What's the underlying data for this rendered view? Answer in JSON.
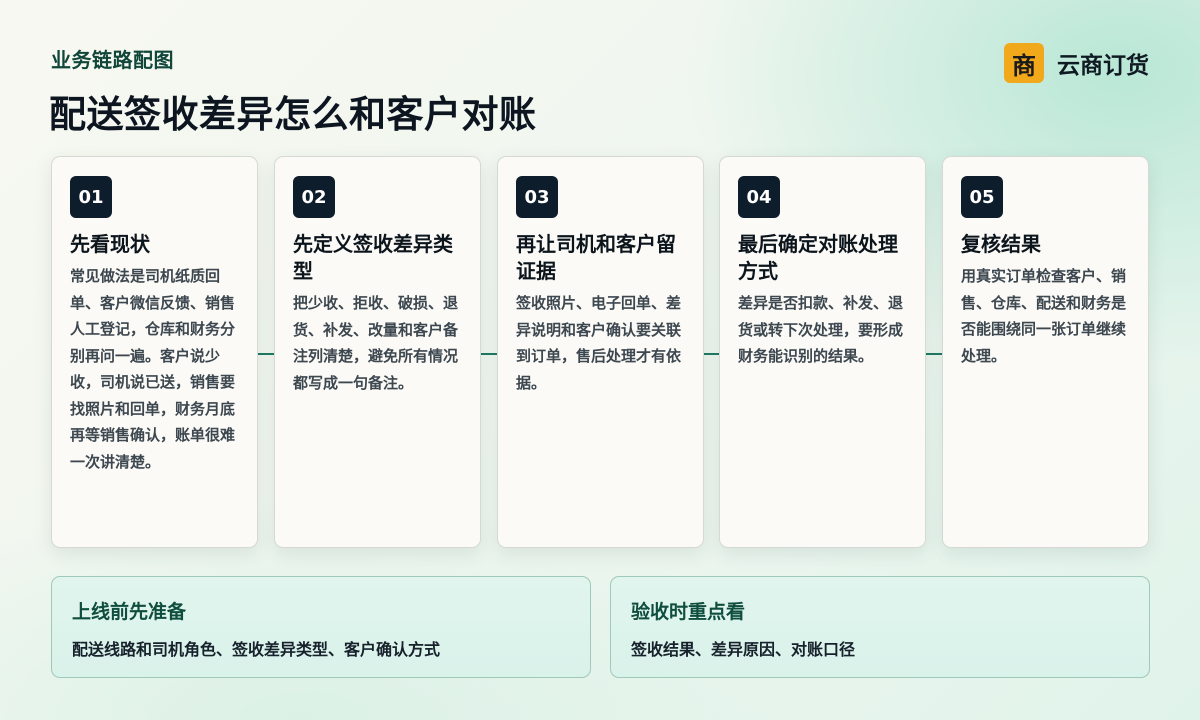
{
  "header": {
    "kicker": "业务链路配图",
    "title": "配送签收差异怎么和客户对账"
  },
  "brand": {
    "badge": "商",
    "name": "云商订货",
    "badge_color": "#f2a81b"
  },
  "steps": [
    {
      "num": "01",
      "title": "先看现状",
      "body": "常见做法是司机纸质回单、客户微信反馈、销售人工登记，仓库和财务分别再问一遍。客户说少收，司机说已送，销售要找照片和回单，财务月底再等销售确认，账单很难一次讲清楚。"
    },
    {
      "num": "02",
      "title": "先定义签收差异类型",
      "body": "把少收、拒收、破损、退货、补发、改量和客户备注列清楚，避免所有情况都写成一句备注。"
    },
    {
      "num": "03",
      "title": "再让司机和客户留证据",
      "body": "签收照片、电子回单、差异说明和客户确认要关联到订单，售后处理才有依据。"
    },
    {
      "num": "04",
      "title": "最后确定对账处理方式",
      "body": "差异是否扣款、补发、退货或转下次处理，要形成财务能识别的结果。"
    },
    {
      "num": "05",
      "title": "复核结果",
      "body": "用真实订单检查客户、销售、仓库、配送和财务是否能围绕同一张订单继续处理。"
    }
  ],
  "panels": [
    {
      "title": "上线前先准备",
      "text": "配送线路和司机角色、签收差异类型、客户确认方式"
    },
    {
      "title": "验收时重点看",
      "text": "签收结果、差异原因、对账口径"
    }
  ],
  "colors": {
    "accent": "#1d7a64",
    "number_badge": "#0e1d2b"
  }
}
